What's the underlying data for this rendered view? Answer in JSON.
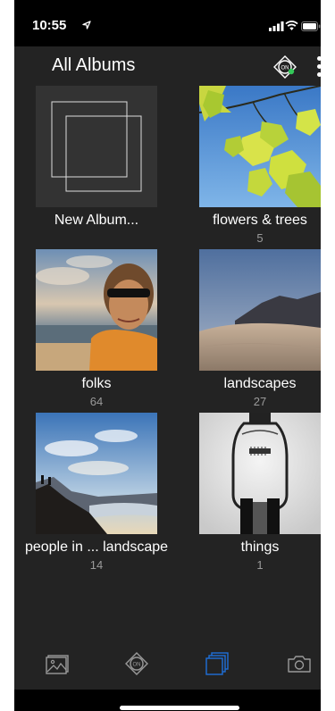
{
  "status_bar": {
    "time": "10:55",
    "icons": [
      "location-arrow-icon",
      "signal-bars-icon",
      "wifi-icon",
      "battery-icon"
    ]
  },
  "header": {
    "title": "All Albums",
    "sync_icon": "sync-status-icon",
    "menu_icon": "more-vertical-icon"
  },
  "albums": [
    {
      "name": "New Album...",
      "count": ""
    },
    {
      "name": "flowers & trees",
      "count": "5"
    },
    {
      "name": "folks",
      "count": "64"
    },
    {
      "name": "landscapes",
      "count": "27"
    },
    {
      "name": "people in ... landscape",
      "count": "14"
    },
    {
      "name": "things",
      "count": "1"
    }
  ],
  "tabs": [
    {
      "icon": "photos-icon",
      "active": false
    },
    {
      "icon": "sync-status-icon",
      "active": false
    },
    {
      "icon": "albums-icon",
      "active": true
    },
    {
      "icon": "camera-icon",
      "active": false
    }
  ],
  "colors": {
    "background": "#232323",
    "status_bar": "#000000",
    "text": "#ffffff",
    "count_text": "#9a9a9a",
    "active_tab": "#1e6fd9",
    "inactive_tab": "#9a9a9a",
    "sync_badge": "#34c759"
  }
}
